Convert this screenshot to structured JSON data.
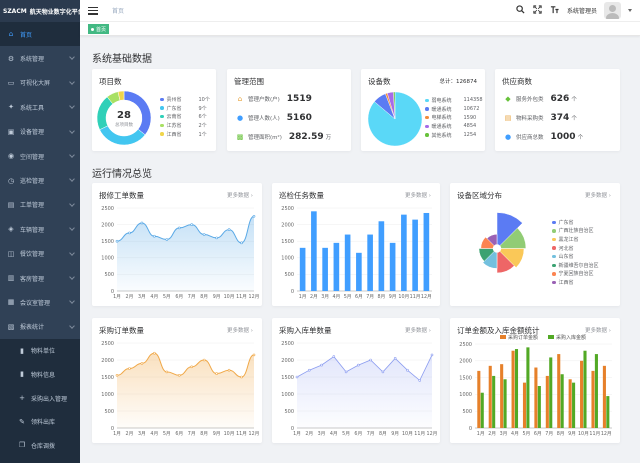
{
  "sidebar": {
    "logo_text": "SZACM",
    "title": "航天物业数字化平台",
    "items": [
      {
        "label": "首页",
        "icon": "home-icon",
        "active": true
      },
      {
        "label": "系统管理",
        "icon": "gear-icon"
      },
      {
        "label": "可视化大屏",
        "icon": "monitor-icon"
      },
      {
        "label": "系统工具",
        "icon": "wrench-icon"
      },
      {
        "label": "设备管理",
        "icon": "device-icon"
      },
      {
        "label": "空间管理",
        "icon": "location-icon"
      },
      {
        "label": "巡检管理",
        "icon": "clock-icon"
      },
      {
        "label": "工单管理",
        "icon": "cart-icon"
      },
      {
        "label": "车辆管理",
        "icon": "car-icon"
      },
      {
        "label": "餐饮管理",
        "icon": "food-icon"
      },
      {
        "label": "客房管理",
        "icon": "bed-icon"
      },
      {
        "label": "会议室管理",
        "icon": "meeting-icon"
      },
      {
        "label": "报表统计",
        "icon": "report-icon"
      }
    ],
    "subitems": [
      {
        "label": "物料单位",
        "icon": "bookmark-icon"
      },
      {
        "label": "物料信息",
        "icon": "bookmark-icon"
      },
      {
        "label": "采购出入管理",
        "icon": "plus-icon"
      },
      {
        "label": "领料出库",
        "icon": "edit-icon"
      },
      {
        "label": "仓库调拨",
        "icon": "copy-icon"
      },
      {
        "label": "...",
        "icon": "list-icon"
      }
    ]
  },
  "header": {
    "breadcrumb": "首页",
    "username": "系统管理员"
  },
  "tags": {
    "active": "首页"
  },
  "section1": {
    "title": "系统基础数据"
  },
  "section2": {
    "title": "运行情况总览"
  },
  "projects": {
    "title": "项目数",
    "center_value": "28",
    "center_label": "总项目数",
    "colors": [
      "#5b7bf3",
      "#42c6f0",
      "#2fd0b8",
      "#a8e063",
      "#f0d54a"
    ],
    "legend": [
      {
        "name": "贵州省",
        "value": "10个",
        "share": 10
      },
      {
        "name": "广东省",
        "value": "9个",
        "share": 9
      },
      {
        "name": "云南省",
        "value": "6个",
        "share": 6
      },
      {
        "name": "江苏省",
        "value": "2个",
        "share": 2
      },
      {
        "name": "江西省",
        "value": "1个",
        "share": 1
      }
    ]
  },
  "management": {
    "title": "管理范围",
    "rows": [
      {
        "label": "管理户数(户)",
        "value": "1519",
        "unit": "",
        "icon": "house-icon",
        "color": "#e6a23c"
      },
      {
        "label": "管理人数(人)",
        "value": "5160",
        "unit": "",
        "icon": "person-icon",
        "color": "#409eff"
      },
      {
        "label": "管理面积(m²)",
        "value": "282.59",
        "unit": "万",
        "icon": "area-icon",
        "color": "#67c23a"
      }
    ]
  },
  "devices": {
    "title": "设备数",
    "total_label": "总计：126874",
    "colors": [
      "#5ad8f7",
      "#5b7bf3",
      "#f08b3c",
      "#a56be8",
      "#67c23a"
    ],
    "legend": [
      {
        "name": "弱电系统",
        "value": "114358",
        "share": 114358
      },
      {
        "name": "暖通系统",
        "value": "10672",
        "share": 10672
      },
      {
        "name": "电梯系统",
        "value": "1590",
        "share": 1590
      },
      {
        "name": "暖通系统",
        "value": "4854",
        "share": 4854
      },
      {
        "name": "其他系统",
        "value": "1254",
        "share": 1254
      }
    ]
  },
  "suppliers": {
    "title": "供应商数",
    "rows": [
      {
        "label": "服务外包类",
        "value": "626",
        "unit": "个",
        "icon": "handshake-icon",
        "color": "#67c23a"
      },
      {
        "label": "物料采购类",
        "value": "374",
        "unit": "个",
        "icon": "cart-icon",
        "color": "#e6a23c"
      },
      {
        "label": "供应商总数",
        "value": "1000",
        "unit": "个",
        "icon": "group-icon",
        "color": "#409eff"
      }
    ]
  },
  "more_label": "更多数据",
  "chart_data": [
    {
      "id": "repair",
      "type": "area",
      "title": "报修工单数量",
      "categories": [
        "1月",
        "2月",
        "3月",
        "4月",
        "5月",
        "6月",
        "7月",
        "8月",
        "9月",
        "10月",
        "11月",
        "12月"
      ],
      "ylim": [
        0,
        2500
      ],
      "yticks": [
        0,
        500,
        1000,
        1500,
        2000,
        2500
      ],
      "color": "#5aa9e6",
      "values": [
        1500,
        1750,
        2050,
        1650,
        1550,
        1900,
        2000,
        1700,
        1600,
        1850,
        1450,
        2250
      ]
    },
    {
      "id": "inspection",
      "type": "bar",
      "title": "巡检任务数量",
      "categories": [
        "1月",
        "2月",
        "3月",
        "4月",
        "5月",
        "6月",
        "7月",
        "8月",
        "9月",
        "10月",
        "11月",
        "12月"
      ],
      "ylim": [
        0,
        2500
      ],
      "yticks": [
        0,
        500,
        1000,
        1500,
        2000,
        2500
      ],
      "color": "#409eff",
      "values": [
        1300,
        2400,
        1300,
        1450,
        1700,
        1150,
        1700,
        2100,
        1450,
        2300,
        2150,
        2350
      ]
    },
    {
      "id": "region",
      "type": "rose",
      "title": "设备区域分布",
      "colors": [
        "#5b7bf3",
        "#91cc75",
        "#fac858",
        "#ee6666",
        "#73c0de",
        "#3ba272",
        "#fc8452",
        "#9a60b4"
      ],
      "legend": [
        {
          "name": "广东省",
          "value": 100
        },
        {
          "name": "广西壮族自治区",
          "value": 78
        },
        {
          "name": "黑龙江省",
          "value": 72
        },
        {
          "name": "河北省",
          "value": 64
        },
        {
          "name": "山东省",
          "value": 50
        },
        {
          "name": "新疆维吾尔自治区",
          "value": 44
        },
        {
          "name": "宁夏回族自治区",
          "value": 38
        },
        {
          "name": "江西省",
          "value": 32
        }
      ]
    },
    {
      "id": "purchase",
      "type": "area",
      "title": "采购订单数量",
      "categories": [
        "1月",
        "2月",
        "3月",
        "4月",
        "5月",
        "6月",
        "7月",
        "8月",
        "9月",
        "10月",
        "11月",
        "12月"
      ],
      "ylim": [
        0,
        2500
      ],
      "yticks": [
        0,
        500,
        1000,
        1500,
        2000,
        2500
      ],
      "color": "#f0a848",
      "values": [
        1550,
        1750,
        1900,
        2200,
        1650,
        1550,
        1800,
        2000,
        1600,
        1700,
        1500,
        2150
      ]
    },
    {
      "id": "instock",
      "type": "line",
      "title": "采购入库单数量",
      "categories": [
        "1月",
        "2月",
        "3月",
        "4月",
        "5月",
        "6月",
        "7月",
        "8月",
        "9月",
        "10月",
        "11月",
        "12月"
      ],
      "ylim": [
        0,
        2500
      ],
      "yticks": [
        0,
        500,
        1000,
        1500,
        2000,
        2500
      ],
      "color": "#8b9cf0",
      "values": [
        1500,
        1700,
        1850,
        2100,
        1650,
        1850,
        2000,
        1650,
        2050,
        1700,
        1400,
        2150
      ]
    },
    {
      "id": "amount",
      "type": "grouped-bar",
      "title": "订单金额及入库金额统计",
      "categories": [
        "1月",
        "2月",
        "3月",
        "4月",
        "5月",
        "6月",
        "7月",
        "8月",
        "9月",
        "10月",
        "11月",
        "12月"
      ],
      "ylim": [
        0,
        2500
      ],
      "yticks": [
        0,
        500,
        1000,
        1500,
        2000,
        2500
      ],
      "series": [
        {
          "name": "采购订单金额",
          "color": "#e6802a",
          "values": [
            1700,
            1850,
            1900,
            2300,
            1350,
            1800,
            1550,
            2200,
            1450,
            2000,
            1700,
            1850
          ]
        },
        {
          "name": "采购入库金额",
          "color": "#52a925",
          "values": [
            1050,
            1550,
            1450,
            2350,
            2400,
            1250,
            2100,
            1600,
            1350,
            2300,
            2200,
            950
          ]
        }
      ]
    }
  ]
}
